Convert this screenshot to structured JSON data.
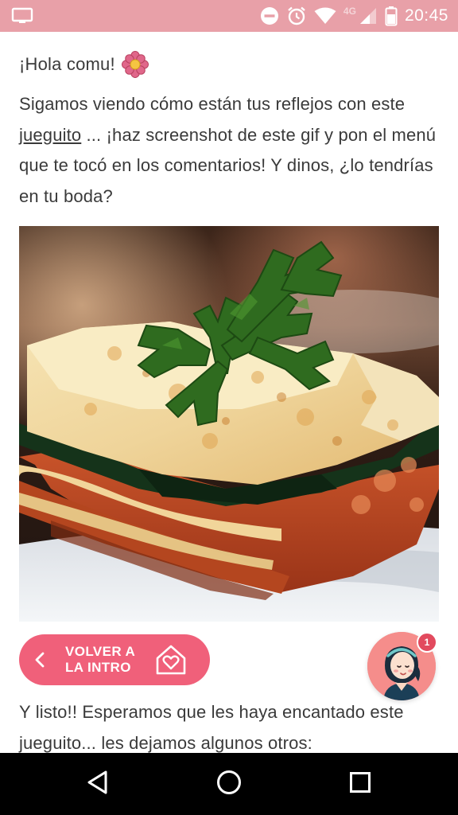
{
  "status_bar": {
    "time": "20:45",
    "network_label": "4G",
    "icons": [
      "screen-cast-icon",
      "do-not-disturb-icon",
      "alarm-icon",
      "wifi-icon",
      "cellular-signal-icon",
      "battery-icon"
    ]
  },
  "post": {
    "greeting": "¡Hola comu!",
    "greeting_icon": "flower-icon",
    "intro_before_link": "Sigamos viendo cómo están tus reflejos con este ",
    "intro_link": "jueguito",
    "intro_after_link": " ... ¡haz screenshot de este gif y pon el menú que te tocó en los comentarios! Y dinos, ¿lo tendrías en tu boda?",
    "image_subject": "lasagna",
    "back_button_label": "VOLVER A LA INTRO",
    "outro": "Y listo!! Esperamos que les haya encantado este jueguito... les dejamos algunos otros:"
  },
  "chat_avatar": {
    "badge_count": "1"
  },
  "nav_bar": {
    "buttons": [
      "back-icon",
      "home-icon",
      "recents-icon"
    ]
  },
  "colors": {
    "status_bar": "#e8a0a8",
    "accent": "#f0607a",
    "badge": "#e24a5e",
    "text": "#3a3a3a"
  }
}
